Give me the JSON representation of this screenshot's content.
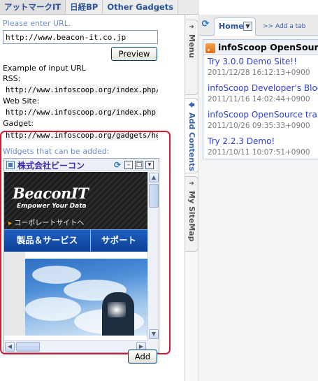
{
  "gadget_tabs": [
    "アットマークIT",
    "日経BP",
    "Other Gadgets"
  ],
  "form": {
    "url_prompt": "Please enter URL.",
    "url_value": "http://www.beacon-it.co.jp",
    "preview_label": "Preview",
    "example_heading": "Example of input URL",
    "rss_label": "RSS:",
    "rss_example": "http://www.infoscoop.org/index.php/en",
    "website_label": "Web Site:",
    "website_example": "http://www.infoscoop.org/index.php",
    "gadget_label": "Gadget:",
    "gadget_example": "http://www.infoscoop.org/gadgets/hel",
    "widgets_label": "Widgets that can be added:",
    "add_label": "Add"
  },
  "widget_preview": {
    "title": "株式会社ビーコン",
    "logo_text": "BeaconIT",
    "tagline": "Empower Your Data",
    "corporate_link": "コーポレートサイトへ",
    "nav_items": [
      "製品＆サービス",
      "サポート"
    ]
  },
  "side_tabs": [
    "Menu",
    "Add Contents",
    "My SiteMap"
  ],
  "page": {
    "home_tab": "Home",
    "add_tab": ">> Add a tab",
    "rss_gadget": {
      "title": "infoScoop OpenSource",
      "items": [
        {
          "title": "Try 3.0.0 Demo Site!!",
          "date": "2011/12/28 16:12:13+0900"
        },
        {
          "title": "infoScoop Developer's Blog",
          "date": "2011/11/16 14:02:44+0900"
        },
        {
          "title": "infoScoop OpenSource trai",
          "date": "2011/10/26 09:35:33+0900"
        },
        {
          "title": "Try 2.2.3 Demo!",
          "date": "2011/10/11 10:07:51+0900"
        }
      ]
    }
  },
  "colors": {
    "highlight_border": "#d8182f",
    "link": "#2d3fd6",
    "tab_text": "#2a5398"
  }
}
